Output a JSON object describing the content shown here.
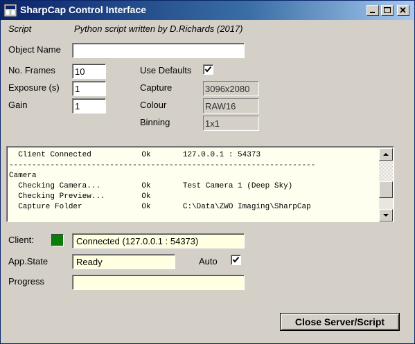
{
  "window": {
    "title": "SharpCap Control Interface"
  },
  "script": {
    "label": "Script",
    "credit": "Python script written by D.Richards (2017)"
  },
  "object_name": {
    "label": "Object Name",
    "value": ""
  },
  "frames": {
    "label": "No. Frames",
    "value": "10"
  },
  "exposure": {
    "label": "Exposure (s)",
    "value": "1"
  },
  "gain": {
    "label": "Gain",
    "value": "1"
  },
  "use_defaults": {
    "label": "Use Defaults",
    "checked": true
  },
  "capture": {
    "label": "Capture",
    "value": "3096x2080"
  },
  "colour": {
    "label": "Colour",
    "value": "RAW16"
  },
  "binning": {
    "label": "Binning",
    "value": "1x1"
  },
  "log": {
    "lines": [
      {
        "text": "  Client Connected           Ok       127.0.0.1 : 54373"
      },
      {
        "text": "-------------------------------------------------------------------"
      },
      {
        "text": "Camera"
      },
      {
        "text": "  Checking Camera...         Ok       Test Camera 1 (Deep Sky)"
      },
      {
        "text": "  Checking Preview...        Ok"
      },
      {
        "text": "  Capture Folder             Ok       C:\\Data\\ZWO Imaging\\SharpCap"
      }
    ]
  },
  "client": {
    "label": "Client:",
    "status_color": "#0a7d0a",
    "value": "Connected (127.0.0.1 : 54373)"
  },
  "app_state": {
    "label": "App.State",
    "value": "Ready"
  },
  "auto": {
    "label": "Auto",
    "checked": true
  },
  "progress": {
    "label": "Progress",
    "value": ""
  },
  "close_button": {
    "label": "Close Server/Script"
  }
}
